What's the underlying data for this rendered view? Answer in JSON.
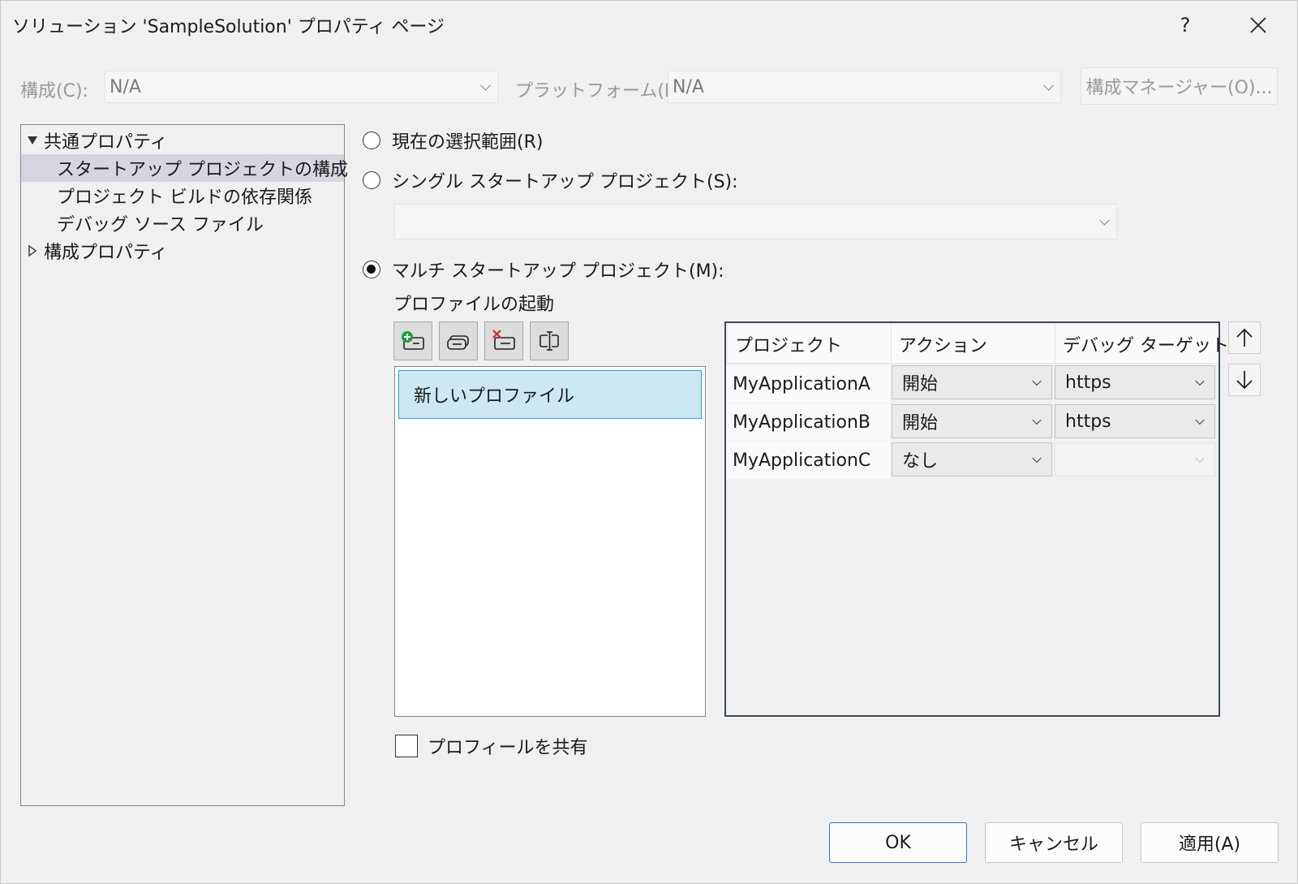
{
  "window": {
    "title": "ソリューション 'SampleSolution' プロパティ ページ",
    "help_label": "?",
    "close_label": "✕"
  },
  "config": {
    "config_label": "構成(C):",
    "config_value": "N/A",
    "platform_label": "プラットフォーム(P):",
    "platform_value": "N/A",
    "manager_button": "構成マネージャー(O)..."
  },
  "tree": {
    "common": "共通プロパティ",
    "items": [
      "スタートアップ プロジェクトの構成",
      "プロジェクト ビルドの依存関係",
      "デバッグ ソース ファイル"
    ],
    "config_props": "構成プロパティ"
  },
  "startup": {
    "current_selection": "現在の選択範囲(R)",
    "single": "シングル スタートアップ プロジェクト(S):",
    "single_value": "",
    "multi": "マルチ スタートアップ プロジェクト(M):",
    "selected_option": "multi"
  },
  "profiles": {
    "heading": "プロファイルの起動",
    "items": [
      "新しいプロファイル"
    ],
    "share_label": "プロフィールを共有",
    "share_checked": false
  },
  "grid": {
    "headers": [
      "プロジェクト",
      "アクション",
      "デバッグ ターゲット"
    ],
    "rows": [
      {
        "project": "MyApplicationA",
        "action": "開始",
        "target": "https"
      },
      {
        "project": "MyApplicationB",
        "action": "開始",
        "target": "https"
      },
      {
        "project": "MyApplicationC",
        "action": "なし",
        "target": ""
      }
    ]
  },
  "buttons": {
    "ok": "OK",
    "cancel": "キャンセル",
    "apply": "適用(A)"
  },
  "colors": {
    "selection_fill": "#cce8f4",
    "selection_border": "#26a0da",
    "default_button_border": "#2c7bd0",
    "add_icon_green": "#1e9e3a",
    "remove_icon_red": "#d62b2b"
  }
}
